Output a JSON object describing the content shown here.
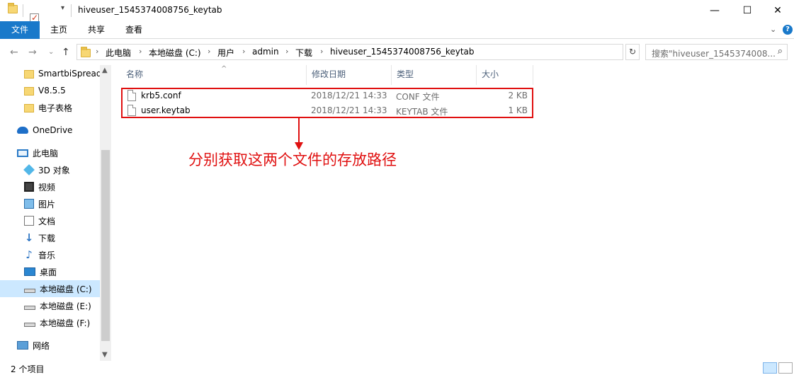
{
  "window": {
    "title": "hiveuser_1545374008756_keytab",
    "minimize": "—",
    "maximize": "☐",
    "close": "✕"
  },
  "ribbon": {
    "tabs": [
      "文件",
      "主页",
      "共享",
      "查看"
    ]
  },
  "address": {
    "crumbs": [
      "此电脑",
      "本地磁盘 (C:)",
      "用户",
      "admin",
      "下载",
      "hiveuser_1545374008756_keytab"
    ],
    "search_placeholder": "搜索\"hiveuser_1545374008...",
    "refresh": "↻"
  },
  "nav": {
    "items": [
      {
        "label": "SmartbiSpread",
        "icon": "folder-icon"
      },
      {
        "label": "V8.5.5",
        "icon": "folder-icon"
      },
      {
        "label": "电子表格",
        "icon": "folder-icon"
      },
      {
        "label": "OneDrive",
        "icon": "onedrive-icon"
      },
      {
        "label": "此电脑",
        "icon": "pc-icon"
      },
      {
        "label": "3D 对象",
        "icon": "3d-objects-icon"
      },
      {
        "label": "视频",
        "icon": "video-icon"
      },
      {
        "label": "图片",
        "icon": "pictures-icon"
      },
      {
        "label": "文档",
        "icon": "documents-icon"
      },
      {
        "label": "下载",
        "icon": "downloads-icon"
      },
      {
        "label": "音乐",
        "icon": "music-icon"
      },
      {
        "label": "桌面",
        "icon": "desktop-icon"
      },
      {
        "label": "本地磁盘 (C:)",
        "icon": "drive-icon",
        "selected": true
      },
      {
        "label": "本地磁盘 (E:)",
        "icon": "drive-icon"
      },
      {
        "label": "本地磁盘 (F:)",
        "icon": "drive-icon"
      },
      {
        "label": "网络",
        "icon": "network-icon"
      }
    ]
  },
  "columns": {
    "name": "名称",
    "modified": "修改日期",
    "type": "类型",
    "size": "大小"
  },
  "files": [
    {
      "name": "krb5.conf",
      "modified": "2018/12/21 14:33",
      "type": "CONF 文件",
      "size": "2 KB"
    },
    {
      "name": "user.keytab",
      "modified": "2018/12/21 14:33",
      "type": "KEYTAB 文件",
      "size": "1 KB"
    }
  ],
  "annotation": {
    "text": "分别获取这两个文件的存放路径",
    "color": "#e01010"
  },
  "status": {
    "item_count": "2 个项目"
  },
  "colors": {
    "accent": "#1979ca",
    "selection": "#cce8ff"
  }
}
